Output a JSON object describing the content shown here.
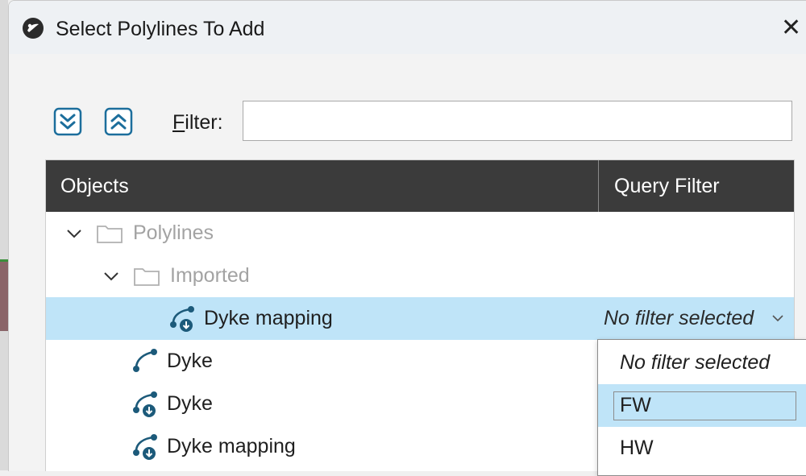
{
  "dialog": {
    "title": "Select Polylines To Add",
    "close_glyph": "✕"
  },
  "toolbar": {
    "expand_all_icon": "chevron-double-down-icon",
    "collapse_all_icon": "chevron-double-up-icon",
    "filter_label_accel": "F",
    "filter_label_rest": "ilter:",
    "filter_value": ""
  },
  "table": {
    "columns": [
      "Objects",
      "Query Filter"
    ],
    "rows": [
      {
        "label": "Polylines",
        "kind": "folder",
        "expanded": true,
        "muted": true
      },
      {
        "label": "Imported",
        "kind": "folder",
        "expanded": true,
        "muted": true
      },
      {
        "label": "Dyke mapping",
        "kind": "polyline-imported",
        "selected": true,
        "query_filter": "No filter selected"
      },
      {
        "label": "Dyke",
        "kind": "polyline"
      },
      {
        "label": "Dyke",
        "kind": "polyline-imported"
      },
      {
        "label": "Dyke mapping",
        "kind": "polyline-imported"
      }
    ]
  },
  "dropdown": {
    "options": [
      "No filter selected",
      "FW",
      "HW"
    ],
    "highlighted": "FW"
  },
  "colors": {
    "header_bg": "#3b3b3b",
    "selection": "#bfe4f8",
    "accent": "#1c6e9c"
  }
}
